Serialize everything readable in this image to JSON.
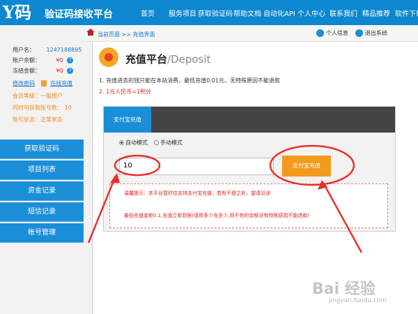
{
  "header": {
    "logo_big": "Y码",
    "logo_sub": "验证码接收平台",
    "nav": [
      "首页",
      "服务项目",
      "获取验证码",
      "帮助文档",
      "自动化API",
      "个人中心",
      "联系我们",
      "精品推荐",
      "软件下载"
    ]
  },
  "sidebar": {
    "username_label": "用户名：",
    "username_value": "1247188895",
    "balance_label": "账户余额：",
    "balance_value": "¥0",
    "frozen_label": "冻结金额：",
    "frozen_value": "¥0",
    "change_password": "修改密码",
    "online_recharge": "在线充值",
    "member_level": "会员等级：一般用户",
    "max_numbers": "同时可获取账号数：   10",
    "account_status": "账号状态：正常状态",
    "menu": [
      "获取验证码",
      "项目列表",
      "资金记录",
      "短信记录",
      "帐号管理"
    ]
  },
  "breadcrumb": {
    "current_page": "当前页面 >> 充值界面",
    "personal_info": "个人信息",
    "logout": "退出系统"
  },
  "main": {
    "title_cn": "充值平台",
    "title_en": "/Deposit",
    "note1": "1. 充值进去的钱只能在本站消费，最低充值0.01元，无特殊原因不能退款",
    "note2": "2. 1元人民币=1积分"
  },
  "panel": {
    "tab_alipay": "支付宝充值",
    "mode_auto": "自动模式",
    "mode_manual": "手动模式",
    "amount_value": "10",
    "pay_button": "支付宝充值",
    "tip1": "温馨提示：本平台暂时仅支持支付宝充值，若有不便之处，望请见谅",
    "tip2": "最低充值金额0.1,充值立即到账(请用多少充多少,用不完的余额没有特殊原因不能退款)"
  },
  "watermark": {
    "brand": "Bai 经验",
    "url": "jingyan.baidu.com"
  },
  "colors": {
    "brand_blue": "#0d87cf",
    "menu_blue": "#1a8fd8",
    "pay_orange": "#f39a1b",
    "annotation_red": "#e8302a"
  }
}
